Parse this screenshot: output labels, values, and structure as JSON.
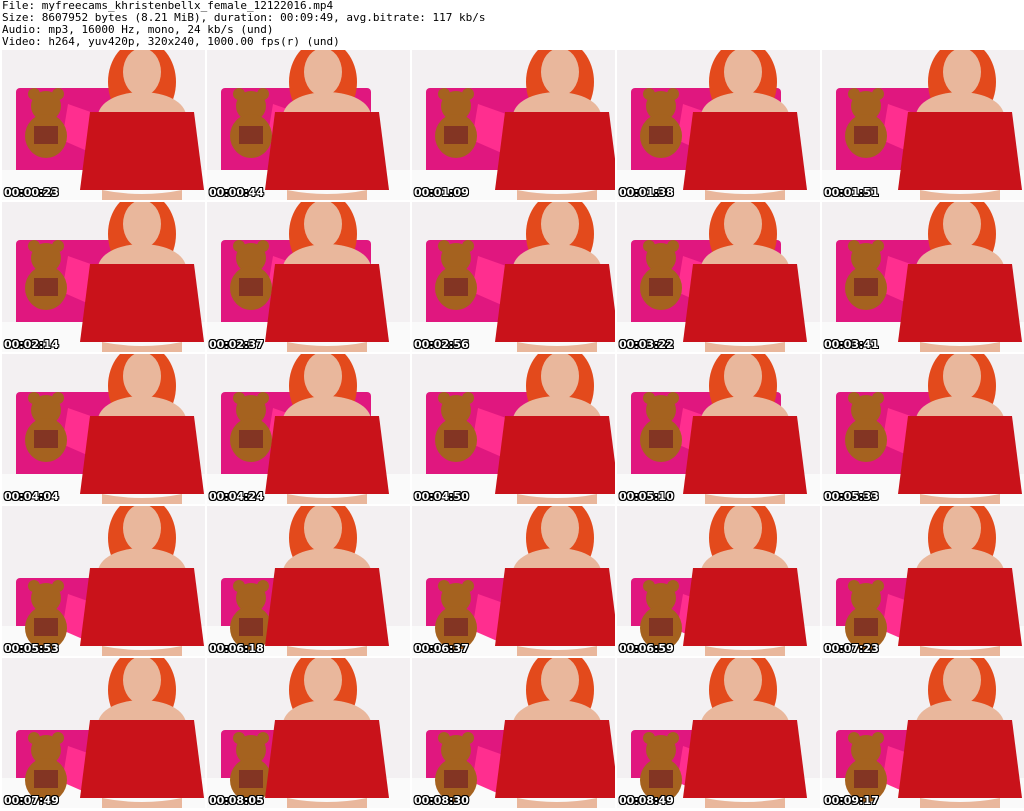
{
  "header": {
    "line1": "File: myfreecams_khristenbellx_female_12122016.mp4",
    "line2": "Size: 8607952 bytes (8.21 MiB), duration: 00:09:49, avg.bitrate: 117 kb/s",
    "line3": "Audio: mp3, 16000 Hz, mono, 24 kb/s (und)",
    "line4": "Video: h264, yuv420p, 320x240, 1000.00 fps(r) (und)"
  },
  "colors": {
    "headboard": "#e0177f",
    "dress": "#c9121a",
    "hair": "#e34a1c",
    "skin": "#e9b79c",
    "teddy": "#a5621f",
    "wall": "#f3f0f2",
    "bed": "#fafafa"
  },
  "thumbnails": [
    {
      "timestamp": "00:00:23"
    },
    {
      "timestamp": "00:00:44"
    },
    {
      "timestamp": "00:01:09"
    },
    {
      "timestamp": "00:01:38"
    },
    {
      "timestamp": "00:01:51"
    },
    {
      "timestamp": "00:02:14"
    },
    {
      "timestamp": "00:02:37"
    },
    {
      "timestamp": "00:02:56"
    },
    {
      "timestamp": "00:03:22"
    },
    {
      "timestamp": "00:03:41"
    },
    {
      "timestamp": "00:04:04"
    },
    {
      "timestamp": "00:04:24"
    },
    {
      "timestamp": "00:04:50"
    },
    {
      "timestamp": "00:05:10"
    },
    {
      "timestamp": "00:05:33"
    },
    {
      "timestamp": "00:05:53"
    },
    {
      "timestamp": "00:06:18"
    },
    {
      "timestamp": "00:06:37"
    },
    {
      "timestamp": "00:06:59"
    },
    {
      "timestamp": "00:07:23"
    },
    {
      "timestamp": "00:07:49"
    },
    {
      "timestamp": "00:08:05"
    },
    {
      "timestamp": "00:08:30"
    },
    {
      "timestamp": "00:08:49"
    },
    {
      "timestamp": "00:09:17"
    }
  ]
}
